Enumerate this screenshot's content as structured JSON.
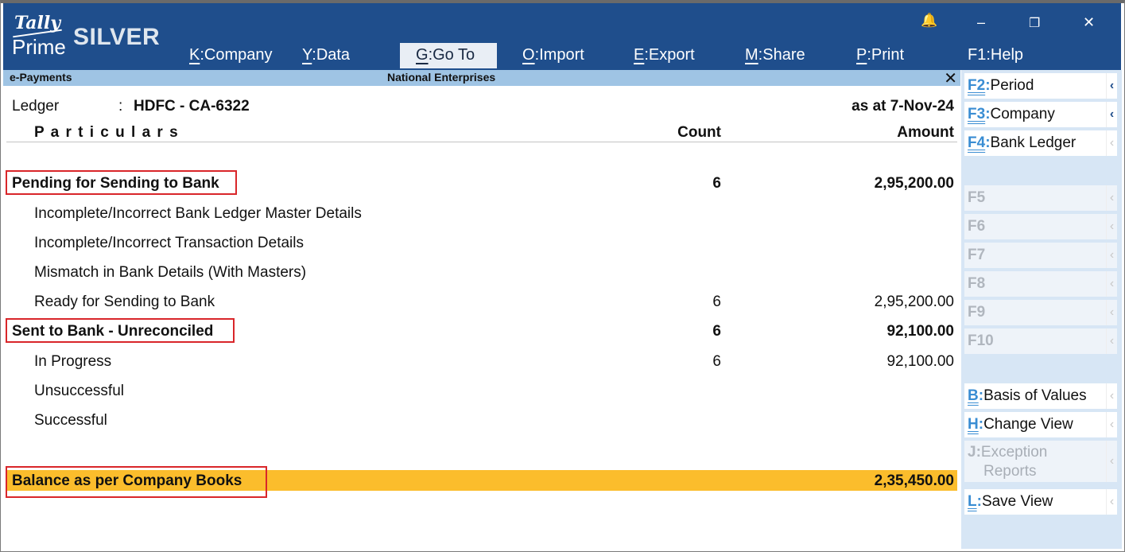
{
  "app": {
    "logo_tally": "Tally",
    "logo_prime": "Prime",
    "edition": "SILVER"
  },
  "menu": [
    {
      "key": "K",
      "label": "Company"
    },
    {
      "key": "Y",
      "label": "Data"
    },
    {
      "key": "G",
      "label": "Go To"
    },
    {
      "key": "O",
      "label": "Import"
    },
    {
      "key": "E",
      "label": "Export"
    },
    {
      "key": "M",
      "label": "Share"
    },
    {
      "key": "P",
      "label": "Print"
    },
    {
      "key": "F1",
      "label": "Help"
    }
  ],
  "window": {
    "bell": "🔔",
    "minimize": "–",
    "restore": "❐",
    "close": "✕"
  },
  "screen": {
    "title": "e-Payments",
    "company": "National Enterprises",
    "close": "✕"
  },
  "report": {
    "ledger_label": "Ledger",
    "ledger_sep": ":",
    "ledger_value": "HDFC - CA-6322",
    "as_at": "as at 7-Nov-24",
    "col_particulars": "P a r t i c u l a r s",
    "col_count": "Count",
    "col_amount": "Amount",
    "rows": [
      {
        "label": "Pending for Sending to Bank",
        "count": "6",
        "amount": "2,95,200.00"
      },
      {
        "label": "Incomplete/Incorrect Bank Ledger Master Details",
        "count": "",
        "amount": ""
      },
      {
        "label": "Incomplete/Incorrect Transaction Details",
        "count": "",
        "amount": ""
      },
      {
        "label": "Mismatch in Bank Details (With Masters)",
        "count": "",
        "amount": ""
      },
      {
        "label": "Ready for Sending to Bank",
        "count": "6",
        "amount": "2,95,200.00"
      },
      {
        "label": "Sent to Bank - Unreconciled",
        "count": "6",
        "amount": "92,100.00"
      },
      {
        "label": "In Progress",
        "count": "6",
        "amount": "92,100.00"
      },
      {
        "label": "Unsuccessful",
        "count": "",
        "amount": ""
      },
      {
        "label": "Successful",
        "count": "",
        "amount": ""
      }
    ],
    "balance_label": "Balance as per Company Books",
    "balance_amount": "2,35,450.00"
  },
  "side_buttons": {
    "f2": {
      "key": "F2",
      "sep": ":",
      "label": "Period"
    },
    "f3": {
      "key": "F3",
      "sep": ":",
      "label": "Company"
    },
    "f4": {
      "key": "F4",
      "sep": ":",
      "label": "Bank Ledger"
    },
    "f5": {
      "key": "F5"
    },
    "f6": {
      "key": "F6"
    },
    "f7": {
      "key": "F7"
    },
    "f8": {
      "key": "F8"
    },
    "f9": {
      "key": "F9"
    },
    "f10": {
      "key": "F10"
    },
    "b": {
      "key": "B",
      "sep": ":",
      "label": "Basis of Values"
    },
    "h": {
      "key": "H",
      "sep": ":",
      "label": "Change View"
    },
    "j": {
      "key": "J",
      "sep": ":",
      "label": "Exception",
      "label2": "Reports"
    },
    "l": {
      "key": "L",
      "sep": ":",
      "label": "Save View"
    },
    "chevron": "‹"
  },
  "colors": {
    "topbar": "#1f4e8c",
    "title_strip": "#9fc4e4",
    "balance_bar": "#fbbd2c",
    "highlight_box": "#d9262a",
    "side_panel": "#d7e6f5",
    "key_accent": "#3a8dd3"
  }
}
